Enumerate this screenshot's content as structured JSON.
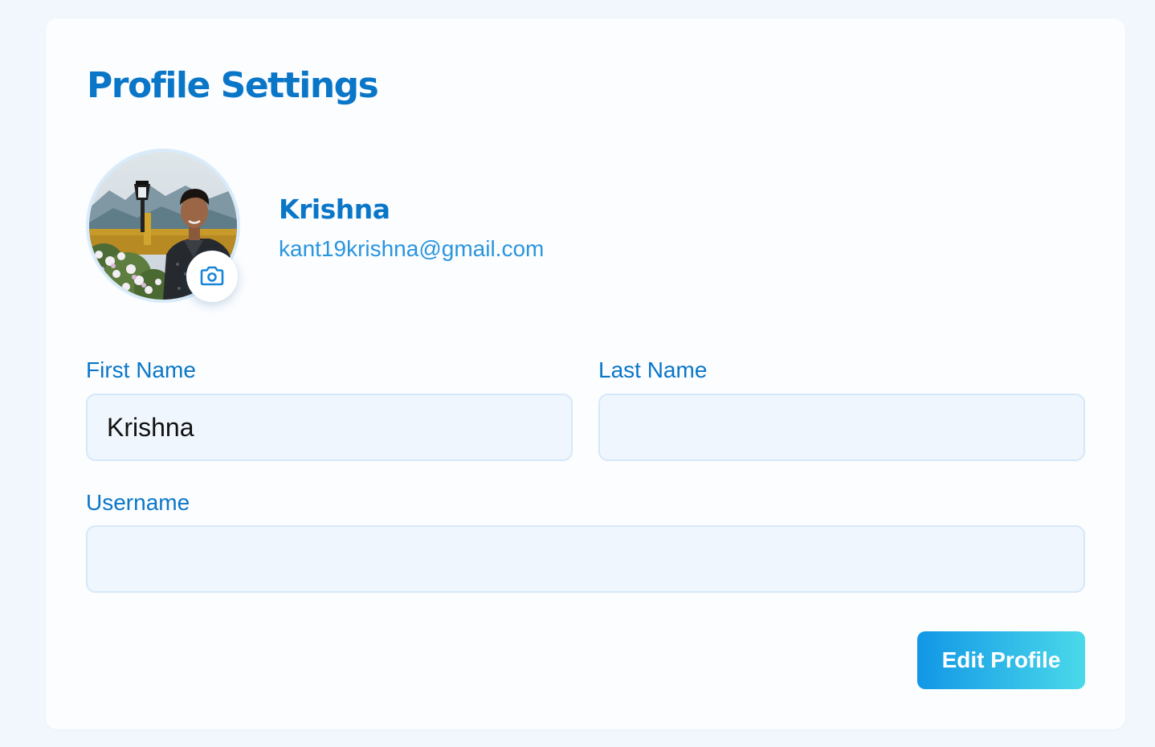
{
  "page": {
    "title": "Profile Settings"
  },
  "profile": {
    "name": "Krishna",
    "email": "kant19krishna@gmail.com",
    "avatar_alt": "profile photo",
    "camera_icon": "camera-icon"
  },
  "form": {
    "first_name": {
      "label": "First Name",
      "value": "Krishna",
      "placeholder": ""
    },
    "last_name": {
      "label": "Last Name",
      "value": "",
      "placeholder": ""
    },
    "username": {
      "label": "Username",
      "value": "",
      "placeholder": ""
    }
  },
  "actions": {
    "edit_label": "Edit Profile"
  },
  "colors": {
    "accent": "#0a76c8",
    "email": "#2b95dd",
    "input_bg": "#eff6fe",
    "button_gradient_start": "#1197e6",
    "button_gradient_end": "#4ad9ea"
  }
}
